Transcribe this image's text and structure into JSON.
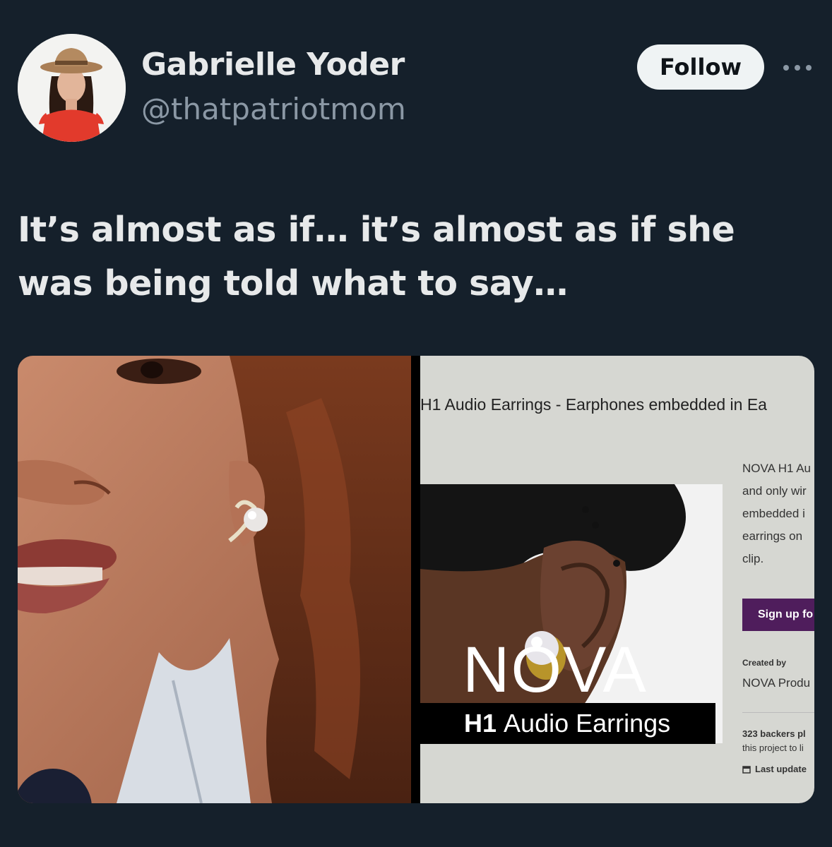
{
  "tweet": {
    "author": {
      "name": "Gabrielle Yoder",
      "handle": "@thatpatriotmom"
    },
    "follow_label": "Follow",
    "more_icon": "more-horizontal-icon",
    "text_lines": [
      "It’s almost as if… it’s almost as if she",
      "was being told what to say…"
    ]
  },
  "media": {
    "right_image": {
      "page_heading": "H1 Audio Earrings - Earphones embedded in Ea",
      "logo_text": "NOVA",
      "banner_bold": "H1",
      "banner_text": "Audio Earrings",
      "description_lines": [
        "NOVA H1 Au",
        "and only wir",
        "embedded i",
        "earrings on",
        "clip."
      ],
      "signup_label": "Sign up fo",
      "created_by_label": "Created by",
      "creator": "NOVA Produ",
      "backers_lines": [
        "323 backers pl",
        "this project to li"
      ],
      "last_update": "Last update"
    }
  },
  "colors": {
    "background": "#15202b",
    "follow_bg": "#eff3f4",
    "handle": "#8b98a5",
    "signup_bg": "#4f1d5c"
  }
}
